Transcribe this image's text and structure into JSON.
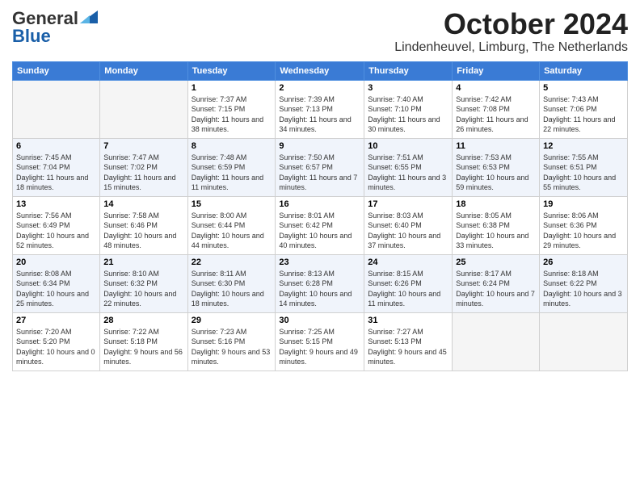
{
  "header": {
    "logo_general": "General",
    "logo_blue": "Blue",
    "month_title": "October 2024",
    "location": "Lindenheuvel, Limburg, The Netherlands"
  },
  "weekdays": [
    "Sunday",
    "Monday",
    "Tuesday",
    "Wednesday",
    "Thursday",
    "Friday",
    "Saturday"
  ],
  "weeks": [
    [
      {
        "day": "",
        "info": ""
      },
      {
        "day": "",
        "info": ""
      },
      {
        "day": "1",
        "info": "Sunrise: 7:37 AM\nSunset: 7:15 PM\nDaylight: 11 hours and 38 minutes."
      },
      {
        "day": "2",
        "info": "Sunrise: 7:39 AM\nSunset: 7:13 PM\nDaylight: 11 hours and 34 minutes."
      },
      {
        "day": "3",
        "info": "Sunrise: 7:40 AM\nSunset: 7:10 PM\nDaylight: 11 hours and 30 minutes."
      },
      {
        "day": "4",
        "info": "Sunrise: 7:42 AM\nSunset: 7:08 PM\nDaylight: 11 hours and 26 minutes."
      },
      {
        "day": "5",
        "info": "Sunrise: 7:43 AM\nSunset: 7:06 PM\nDaylight: 11 hours and 22 minutes."
      }
    ],
    [
      {
        "day": "6",
        "info": "Sunrise: 7:45 AM\nSunset: 7:04 PM\nDaylight: 11 hours and 18 minutes."
      },
      {
        "day": "7",
        "info": "Sunrise: 7:47 AM\nSunset: 7:02 PM\nDaylight: 11 hours and 15 minutes."
      },
      {
        "day": "8",
        "info": "Sunrise: 7:48 AM\nSunset: 6:59 PM\nDaylight: 11 hours and 11 minutes."
      },
      {
        "day": "9",
        "info": "Sunrise: 7:50 AM\nSunset: 6:57 PM\nDaylight: 11 hours and 7 minutes."
      },
      {
        "day": "10",
        "info": "Sunrise: 7:51 AM\nSunset: 6:55 PM\nDaylight: 11 hours and 3 minutes."
      },
      {
        "day": "11",
        "info": "Sunrise: 7:53 AM\nSunset: 6:53 PM\nDaylight: 10 hours and 59 minutes."
      },
      {
        "day": "12",
        "info": "Sunrise: 7:55 AM\nSunset: 6:51 PM\nDaylight: 10 hours and 55 minutes."
      }
    ],
    [
      {
        "day": "13",
        "info": "Sunrise: 7:56 AM\nSunset: 6:49 PM\nDaylight: 10 hours and 52 minutes."
      },
      {
        "day": "14",
        "info": "Sunrise: 7:58 AM\nSunset: 6:46 PM\nDaylight: 10 hours and 48 minutes."
      },
      {
        "day": "15",
        "info": "Sunrise: 8:00 AM\nSunset: 6:44 PM\nDaylight: 10 hours and 44 minutes."
      },
      {
        "day": "16",
        "info": "Sunrise: 8:01 AM\nSunset: 6:42 PM\nDaylight: 10 hours and 40 minutes."
      },
      {
        "day": "17",
        "info": "Sunrise: 8:03 AM\nSunset: 6:40 PM\nDaylight: 10 hours and 37 minutes."
      },
      {
        "day": "18",
        "info": "Sunrise: 8:05 AM\nSunset: 6:38 PM\nDaylight: 10 hours and 33 minutes."
      },
      {
        "day": "19",
        "info": "Sunrise: 8:06 AM\nSunset: 6:36 PM\nDaylight: 10 hours and 29 minutes."
      }
    ],
    [
      {
        "day": "20",
        "info": "Sunrise: 8:08 AM\nSunset: 6:34 PM\nDaylight: 10 hours and 25 minutes."
      },
      {
        "day": "21",
        "info": "Sunrise: 8:10 AM\nSunset: 6:32 PM\nDaylight: 10 hours and 22 minutes."
      },
      {
        "day": "22",
        "info": "Sunrise: 8:11 AM\nSunset: 6:30 PM\nDaylight: 10 hours and 18 minutes."
      },
      {
        "day": "23",
        "info": "Sunrise: 8:13 AM\nSunset: 6:28 PM\nDaylight: 10 hours and 14 minutes."
      },
      {
        "day": "24",
        "info": "Sunrise: 8:15 AM\nSunset: 6:26 PM\nDaylight: 10 hours and 11 minutes."
      },
      {
        "day": "25",
        "info": "Sunrise: 8:17 AM\nSunset: 6:24 PM\nDaylight: 10 hours and 7 minutes."
      },
      {
        "day": "26",
        "info": "Sunrise: 8:18 AM\nSunset: 6:22 PM\nDaylight: 10 hours and 3 minutes."
      }
    ],
    [
      {
        "day": "27",
        "info": "Sunrise: 7:20 AM\nSunset: 5:20 PM\nDaylight: 10 hours and 0 minutes."
      },
      {
        "day": "28",
        "info": "Sunrise: 7:22 AM\nSunset: 5:18 PM\nDaylight: 9 hours and 56 minutes."
      },
      {
        "day": "29",
        "info": "Sunrise: 7:23 AM\nSunset: 5:16 PM\nDaylight: 9 hours and 53 minutes."
      },
      {
        "day": "30",
        "info": "Sunrise: 7:25 AM\nSunset: 5:15 PM\nDaylight: 9 hours and 49 minutes."
      },
      {
        "day": "31",
        "info": "Sunrise: 7:27 AM\nSunset: 5:13 PM\nDaylight: 9 hours and 45 minutes."
      },
      {
        "day": "",
        "info": ""
      },
      {
        "day": "",
        "info": ""
      }
    ]
  ]
}
